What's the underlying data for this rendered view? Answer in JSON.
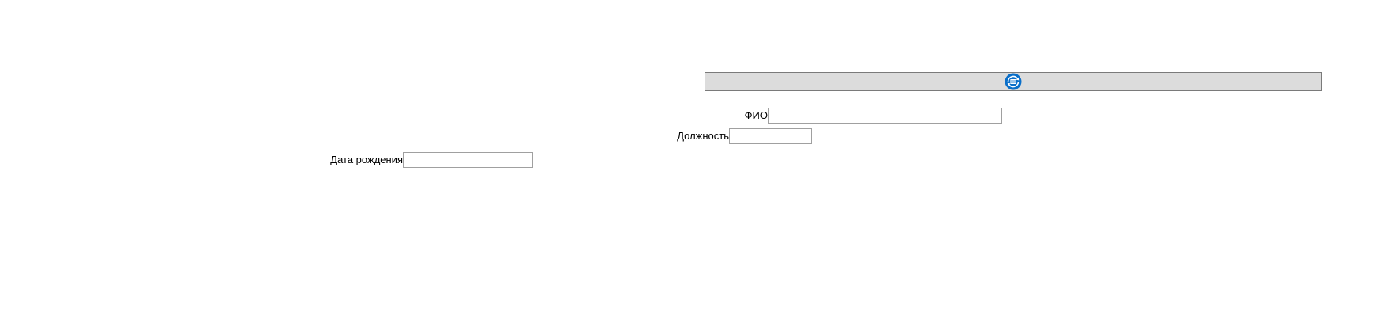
{
  "toolbar": {
    "action_icon": "refresh-database-icon",
    "accent_color": "#0a6fc9",
    "background_color": "#dcdcdc"
  },
  "form": {
    "fio": {
      "label": "ФИО",
      "value": "",
      "placeholder": ""
    },
    "position": {
      "label": "Должность",
      "value": "",
      "placeholder": ""
    },
    "birth_date": {
      "label": "Дата рождения",
      "value": "",
      "placeholder": ""
    }
  }
}
